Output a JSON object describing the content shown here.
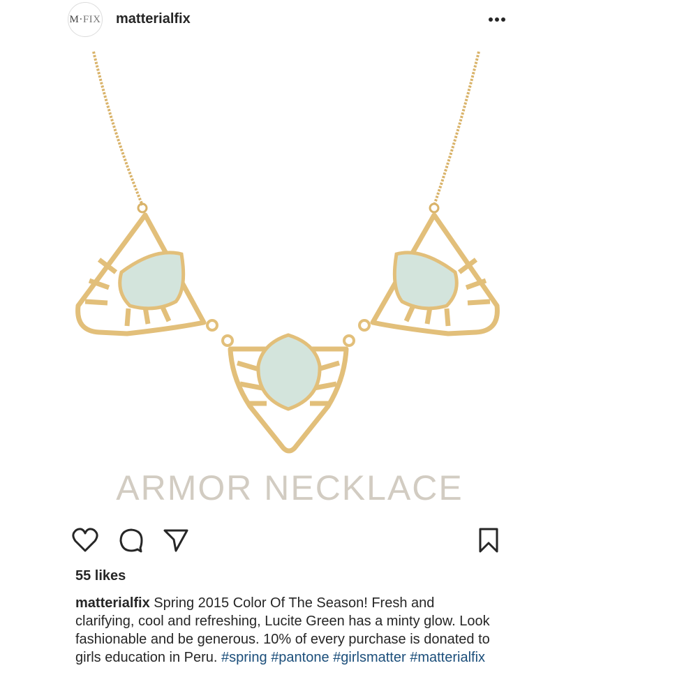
{
  "post": {
    "username": "matterialfix",
    "avatar_text_left": "M·",
    "avatar_text_right": "FIX",
    "image": {
      "overlay_text": "ARMOR NECKLACE",
      "gold_color": "#e2bf7a",
      "stone_color": "#d3e4dc",
      "text_color": "#d2ccc2"
    },
    "icons": {
      "more": "more-options-icon",
      "like": "heart-icon",
      "comment": "comment-icon",
      "share": "send-icon",
      "save": "bookmark-icon"
    },
    "likes_text": "55 likes",
    "caption": {
      "username": "matterialfix",
      "text": " Spring 2015 Color Of The Season! Fresh and clarifying, cool and refreshing, Lucite Green has a minty glow. Look fashionable and be generous. 10% of every purchase is donated to girls education in Peru. ",
      "hashtags": [
        "#spring",
        "#pantone",
        "#girlsmatter",
        "#matterialfix"
      ]
    }
  }
}
